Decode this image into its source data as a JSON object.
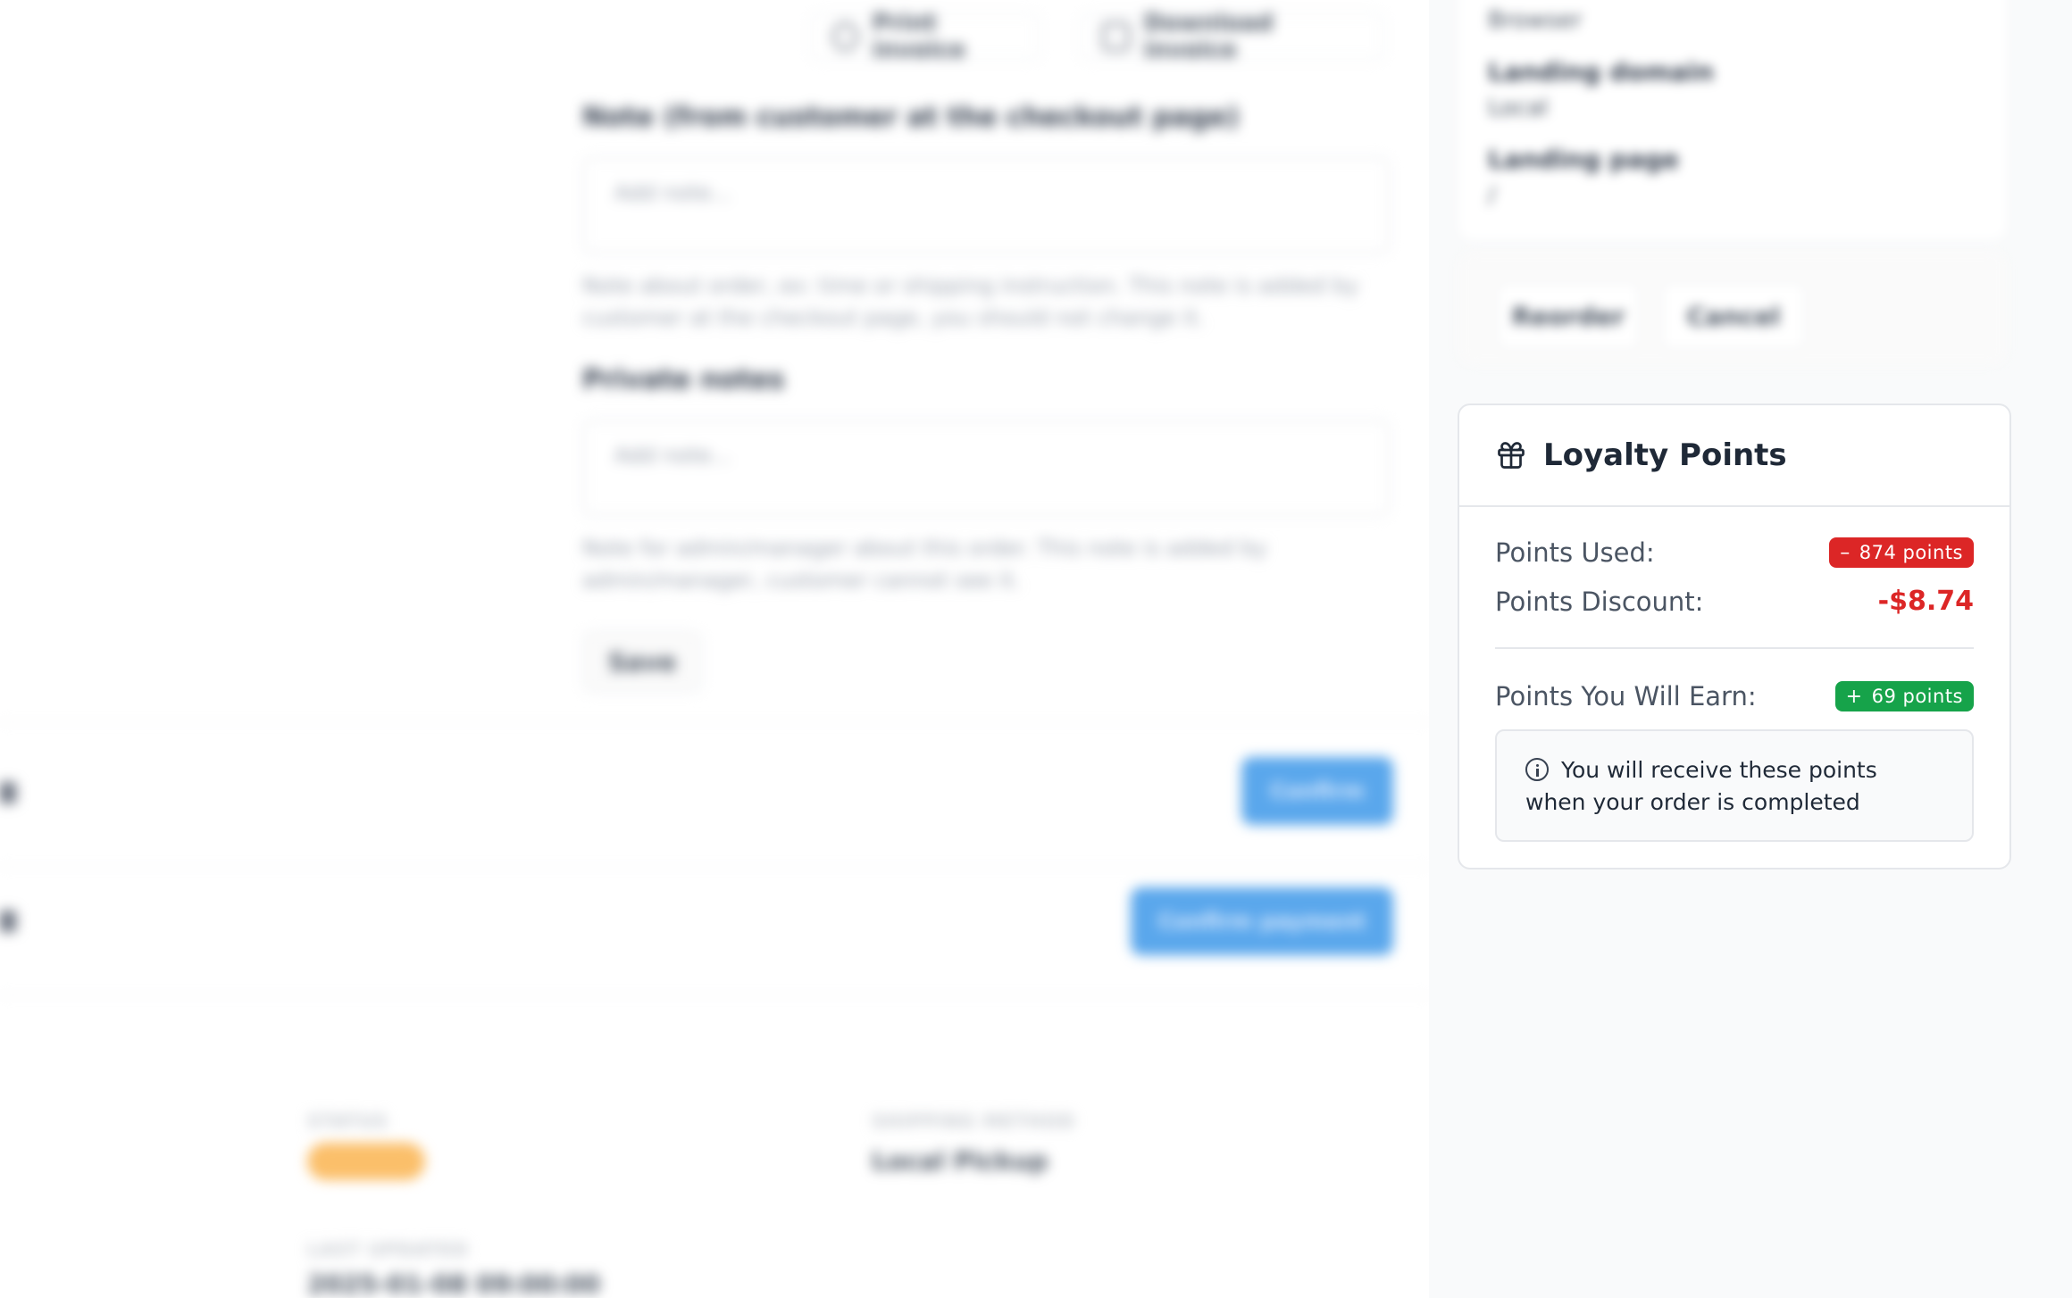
{
  "toolbar": {
    "print_label": "Print invoice",
    "download_label": "Download invoice"
  },
  "notes": {
    "customer_note_label": "Note (from customer at the checkout page)",
    "customer_note_placeholder": "Add note...",
    "customer_note_help": "Note about order, ex: time or shipping instruction. This note is added by customer at the checkout page, you should not change it.",
    "private_note_label": "Private notes",
    "private_note_placeholder": "Add note...",
    "private_note_help": "Note for admin/manager about this order. This note is added by admin/manager, customer cannot see it.",
    "save_label": "Save"
  },
  "actions": {
    "confirm_label": "Confirm",
    "confirm_payment_label": "Confirm payment"
  },
  "shipment": {
    "status_label": "STATUS",
    "method_label": "SHIPPING METHOD",
    "method_value": "Local Pickup",
    "updated_label": "LAST UPDATED",
    "updated_value": "2025-01-08 09:00:00"
  },
  "meta": {
    "browser_value": "Browser",
    "landing_domain_label": "Landing domain",
    "landing_domain_value": "Local",
    "landing_page_label": "Landing page",
    "landing_page_value": "/",
    "reorder_label": "Reorder",
    "cancel_label": "Cancel"
  },
  "loyalty": {
    "title": "Loyalty Points",
    "points_used_label": "Points Used:",
    "points_used_badge": "874 points",
    "points_used_sign": "–",
    "points_discount_label": "Points Discount:",
    "points_discount_value": "-$8.74",
    "points_earn_label": "Points You Will Earn:",
    "points_earn_badge": "69 points",
    "points_earn_sign": "+",
    "notice": "You will receive these points when your order is completed"
  },
  "colors": {
    "danger": "#dc2626",
    "success": "#16a34a",
    "primary": "#5aa7ec",
    "warning": "#fbbf6a"
  },
  "icons": {
    "loyalty_title": "gift-icon",
    "notice": "info-icon",
    "print": "printer-icon",
    "download": "download-icon"
  }
}
